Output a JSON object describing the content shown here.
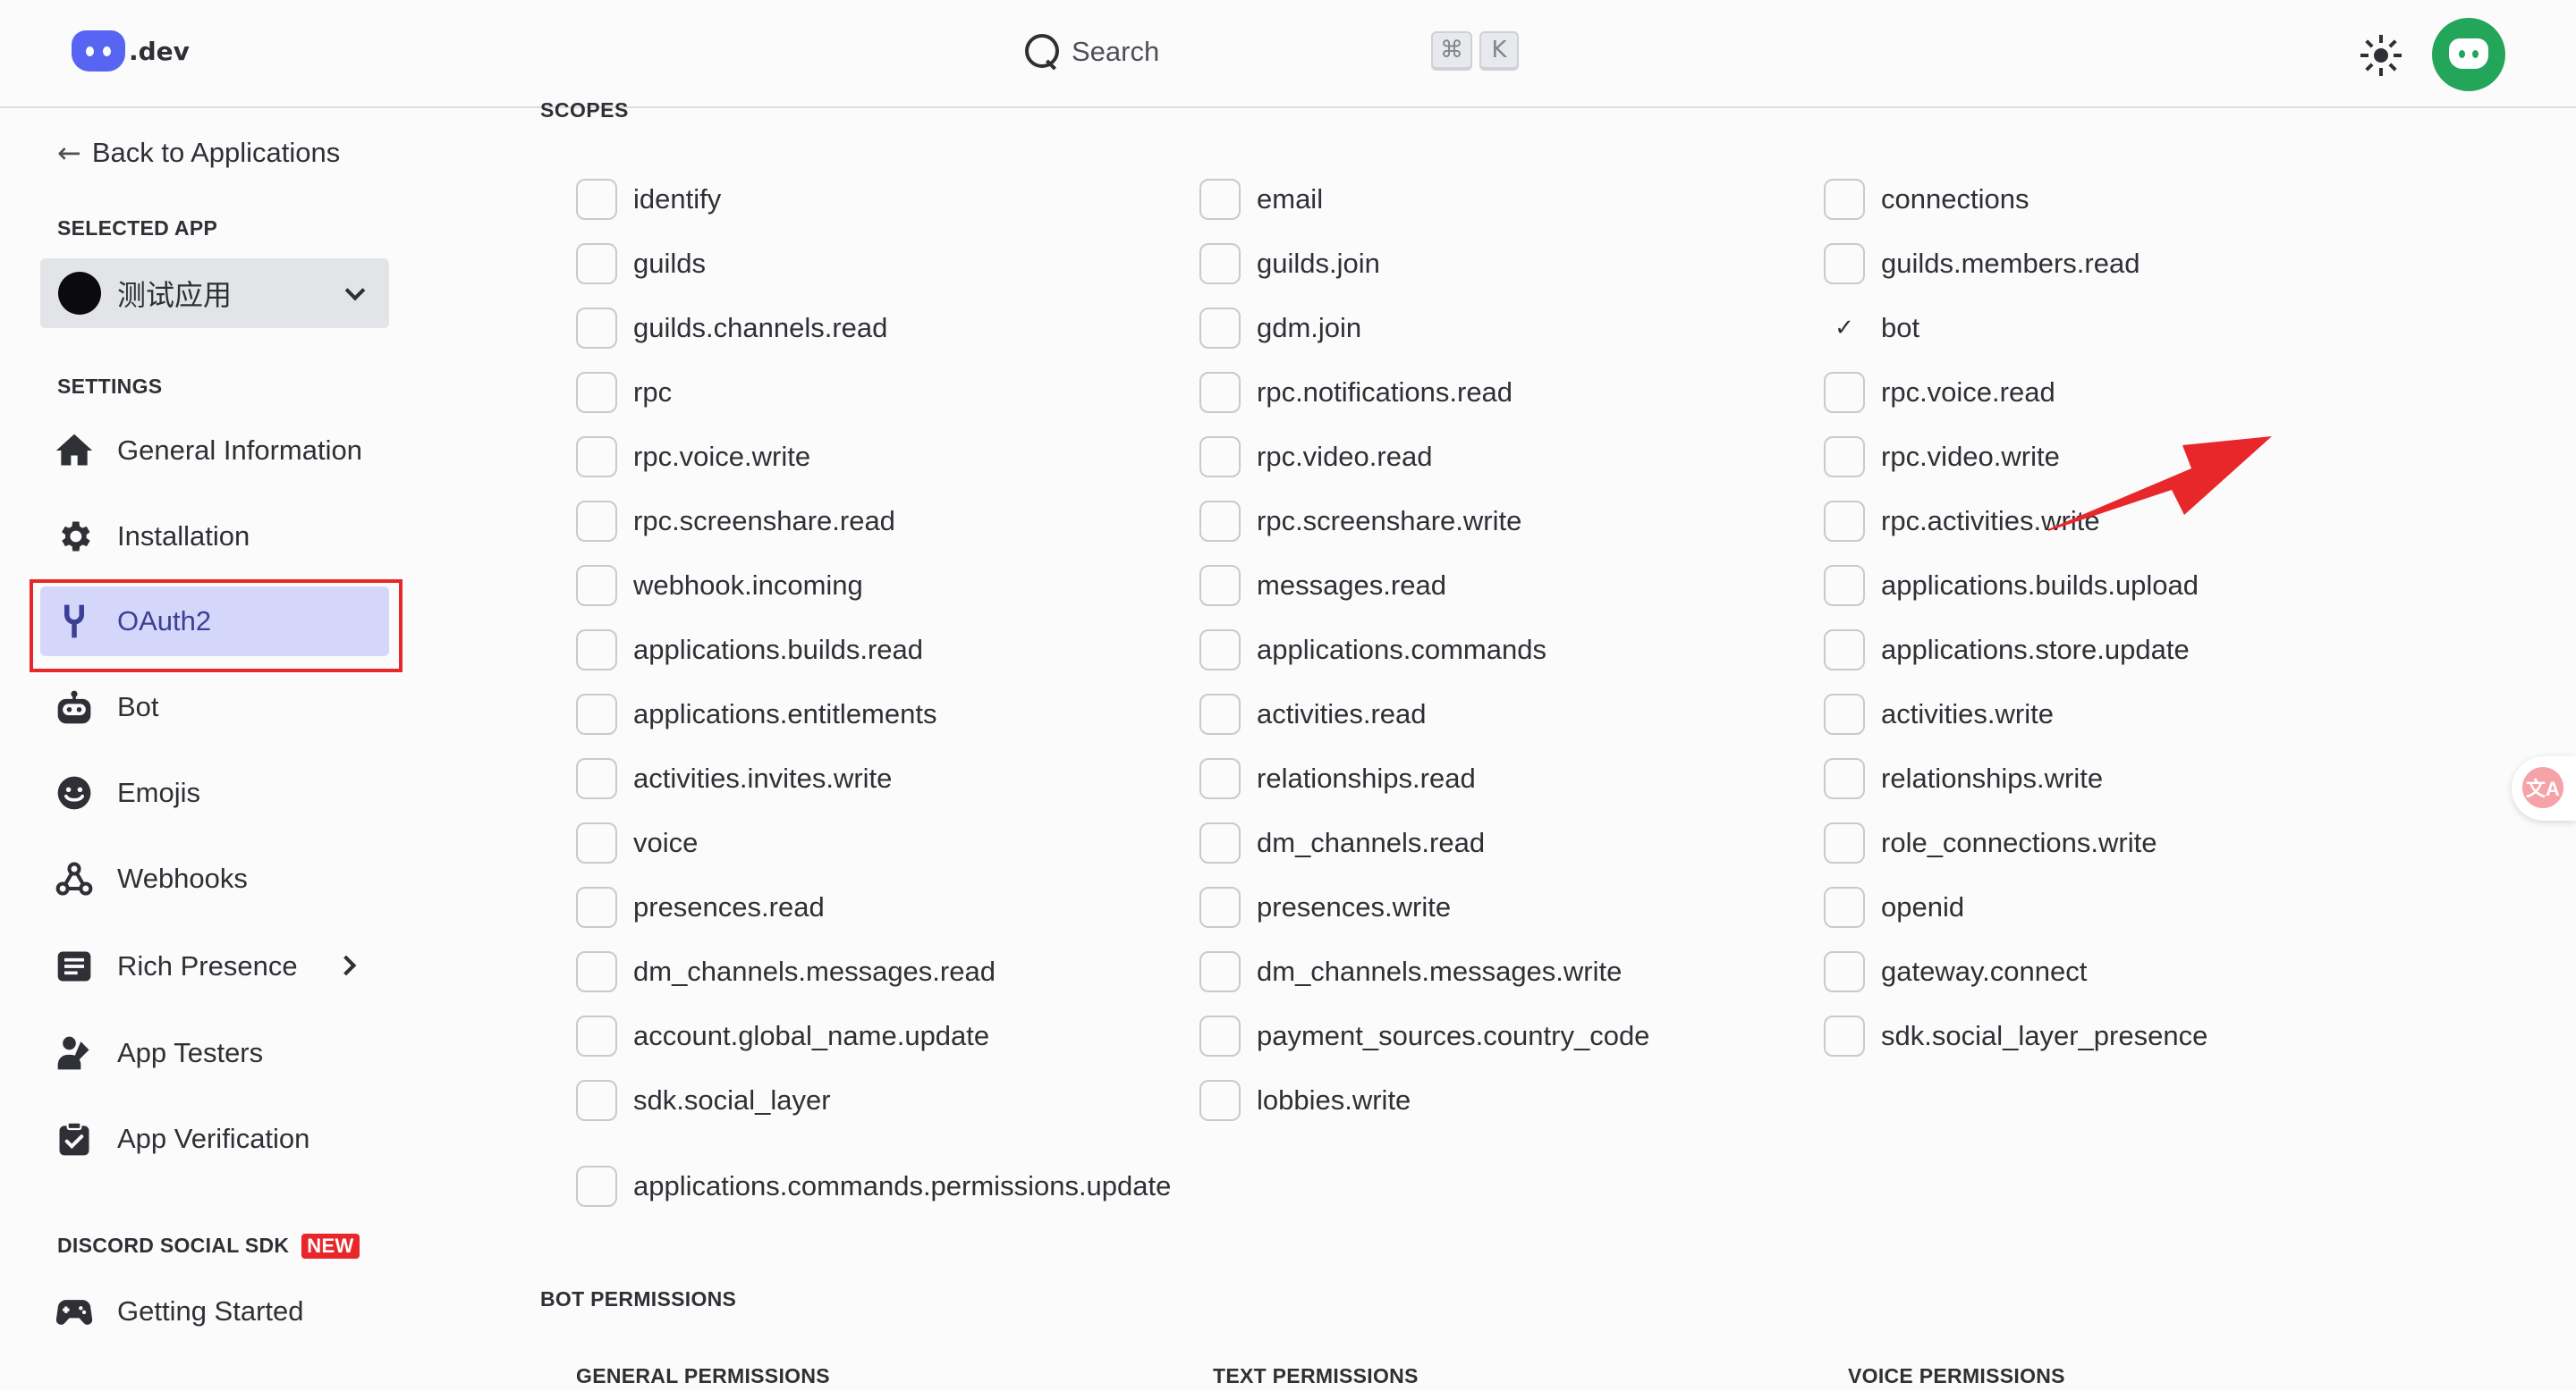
{
  "header": {
    "logo_text": ".dev",
    "search_label": "Search",
    "shortcut_keys": [
      "⌘",
      "K"
    ]
  },
  "sidebar": {
    "back_label": "Back to Applications",
    "selected_app_label": "SELECTED APP",
    "selected_app_name": "测试应用",
    "settings_label": "SETTINGS",
    "items": [
      {
        "label": "General Information",
        "icon": "home-icon"
      },
      {
        "label": "Installation",
        "icon": "gear-icon"
      },
      {
        "label": "OAuth2",
        "icon": "wrench-icon",
        "active": true
      },
      {
        "label": "Bot",
        "icon": "bot-icon"
      },
      {
        "label": "Emojis",
        "icon": "emoji-icon"
      },
      {
        "label": "Webhooks",
        "icon": "webhook-icon"
      },
      {
        "label": "Rich Presence",
        "icon": "rich-presence-icon"
      },
      {
        "label": "App Testers",
        "icon": "app-testers-icon"
      },
      {
        "label": "App Verification",
        "icon": "verification-icon"
      }
    ],
    "sdk_label": "DISCORD SOCIAL SDK",
    "sdk_badge": "NEW",
    "sdk_items": [
      {
        "label": "Getting Started",
        "icon": "gamepad-icon"
      }
    ]
  },
  "main": {
    "scopes_heading": "SCOPES",
    "scopes": [
      {
        "label": "identify",
        "checked": false
      },
      {
        "label": "email",
        "checked": false
      },
      {
        "label": "connections",
        "checked": false
      },
      {
        "label": "guilds",
        "checked": false
      },
      {
        "label": "guilds.join",
        "checked": false
      },
      {
        "label": "guilds.members.read",
        "checked": false
      },
      {
        "label": "guilds.channels.read",
        "checked": false
      },
      {
        "label": "gdm.join",
        "checked": false
      },
      {
        "label": "bot",
        "checked": true
      },
      {
        "label": "rpc",
        "checked": false
      },
      {
        "label": "rpc.notifications.read",
        "checked": false
      },
      {
        "label": "rpc.voice.read",
        "checked": false
      },
      {
        "label": "rpc.voice.write",
        "checked": false
      },
      {
        "label": "rpc.video.read",
        "checked": false
      },
      {
        "label": "rpc.video.write",
        "checked": false
      },
      {
        "label": "rpc.screenshare.read",
        "checked": false
      },
      {
        "label": "rpc.screenshare.write",
        "checked": false
      },
      {
        "label": "rpc.activities.write",
        "checked": false
      },
      {
        "label": "webhook.incoming",
        "checked": false
      },
      {
        "label": "messages.read",
        "checked": false
      },
      {
        "label": "applications.builds.upload",
        "checked": false
      },
      {
        "label": "applications.builds.read",
        "checked": false
      },
      {
        "label": "applications.commands",
        "checked": false
      },
      {
        "label": "applications.store.update",
        "checked": false
      },
      {
        "label": "applications.entitlements",
        "checked": false
      },
      {
        "label": "activities.read",
        "checked": false
      },
      {
        "label": "activities.write",
        "checked": false
      },
      {
        "label": "activities.invites.write",
        "checked": false
      },
      {
        "label": "relationships.read",
        "checked": false
      },
      {
        "label": "relationships.write",
        "checked": false
      },
      {
        "label": "voice",
        "checked": false
      },
      {
        "label": "dm_channels.read",
        "checked": false
      },
      {
        "label": "role_connections.write",
        "checked": false
      },
      {
        "label": "presences.read",
        "checked": false
      },
      {
        "label": "presences.write",
        "checked": false
      },
      {
        "label": "openid",
        "checked": false
      },
      {
        "label": "dm_channels.messages.read",
        "checked": false
      },
      {
        "label": "dm_channels.messages.write",
        "checked": false
      },
      {
        "label": "gateway.connect",
        "checked": false
      },
      {
        "label": "account.global_name.update",
        "checked": false
      },
      {
        "label": "payment_sources.country_code",
        "checked": false
      },
      {
        "label": "sdk.social_layer_presence",
        "checked": false
      },
      {
        "label": "sdk.social_layer",
        "checked": false
      },
      {
        "label": "lobbies.write",
        "checked": false
      },
      {
        "label": "applications.commands.permissions.update",
        "checked": false
      }
    ],
    "bot_permissions_heading": "BOT PERMISSIONS",
    "permission_groups": [
      "GENERAL PERMISSIONS",
      "TEXT PERMISSIONS",
      "VOICE PERMISSIONS"
    ],
    "annotation_color": "#e8272b",
    "accent_color": "#5865f2"
  },
  "floating": {
    "translate_label": "文A"
  }
}
